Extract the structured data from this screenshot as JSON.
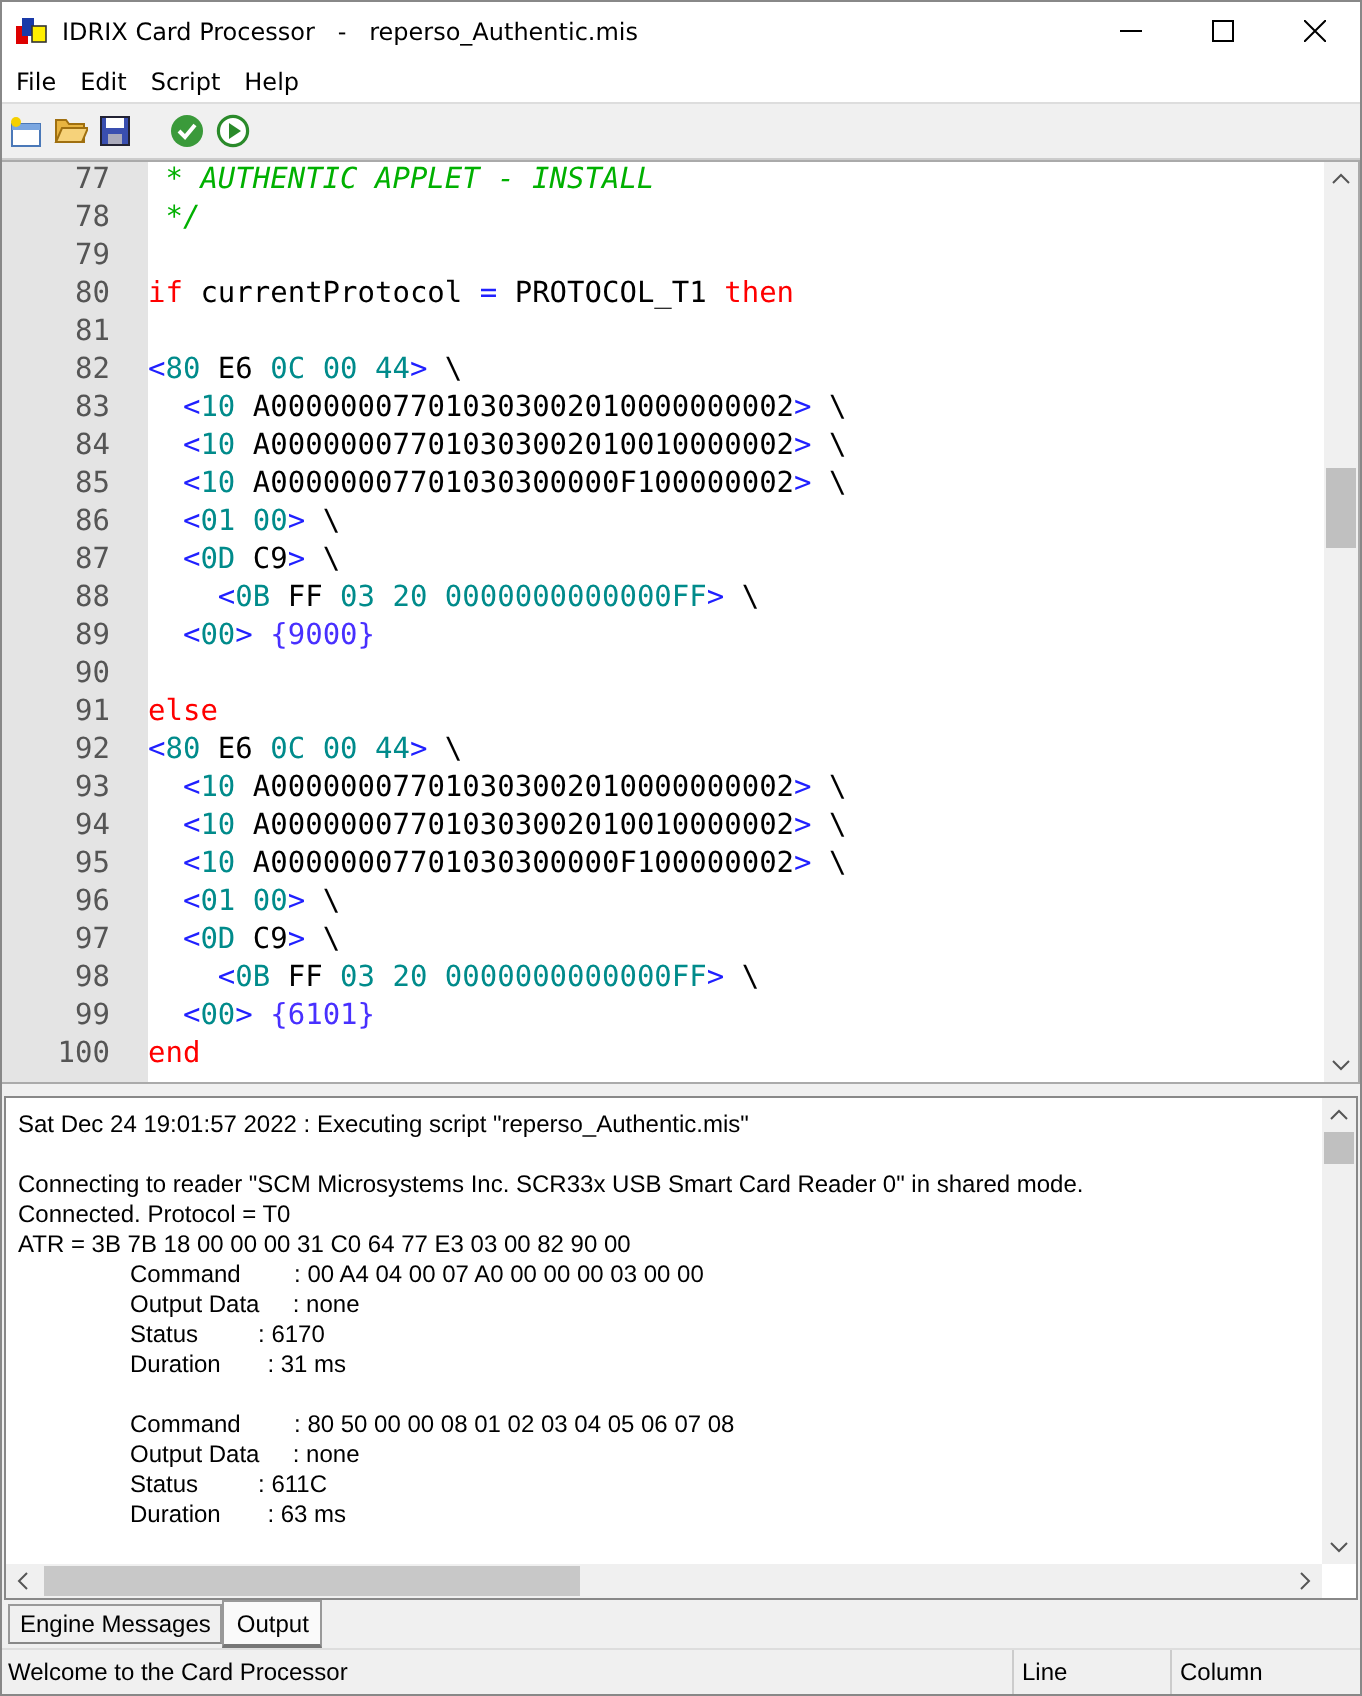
{
  "window": {
    "title": "IDRIX Card Processor   -   reperso_Authentic.mis"
  },
  "menu": [
    "File",
    "Edit",
    "Script",
    "Help"
  ],
  "editor": {
    "lines": [
      {
        "number": "77",
        "tokens": [
          {
            "kind": "comment",
            "text": " * AUTHENTIC APPLET - INSTALL"
          }
        ]
      },
      {
        "number": "78",
        "tokens": [
          {
            "kind": "comment",
            "text": " */"
          }
        ]
      },
      {
        "number": "79"
      },
      {
        "number": "80",
        "tokens": [
          {
            "kind": "keyword",
            "text": "if"
          },
          {
            "kind": "plain",
            "text": " currentProtocol "
          },
          {
            "kind": "punct",
            "text": "="
          },
          {
            "kind": "plain",
            "text": " PROTOCOL_T1 "
          },
          {
            "kind": "keyword",
            "text": "then"
          }
        ]
      },
      {
        "number": "81"
      },
      {
        "number": "82",
        "tokens": [
          {
            "kind": "punct",
            "text": "<"
          },
          {
            "kind": "num",
            "text": "80"
          },
          {
            "kind": "plain",
            "text": " E6 "
          },
          {
            "kind": "num",
            "text": "0C 00 44"
          },
          {
            "kind": "punct",
            "text": ">"
          },
          {
            "kind": "plain",
            "text": " \\"
          }
        ]
      },
      {
        "number": "83",
        "tokens": [
          {
            "kind": "punct",
            "text": "  <"
          },
          {
            "kind": "num",
            "text": "10"
          },
          {
            "kind": "plain",
            "text": " A000000077010303002010000000002"
          },
          {
            "kind": "punct",
            "text": ">"
          },
          {
            "kind": "plain",
            "text": " \\"
          }
        ]
      },
      {
        "number": "84",
        "tokens": [
          {
            "kind": "punct",
            "text": "  <"
          },
          {
            "kind": "num",
            "text": "10"
          },
          {
            "kind": "plain",
            "text": " A000000077010303002010010000002"
          },
          {
            "kind": "punct",
            "text": ">"
          },
          {
            "kind": "plain",
            "text": " \\"
          }
        ]
      },
      {
        "number": "85",
        "tokens": [
          {
            "kind": "punct",
            "text": "  <"
          },
          {
            "kind": "num",
            "text": "10"
          },
          {
            "kind": "plain",
            "text": " A00000007701030300000F100000002"
          },
          {
            "kind": "punct",
            "text": ">"
          },
          {
            "kind": "plain",
            "text": " \\"
          }
        ]
      },
      {
        "number": "86",
        "tokens": [
          {
            "kind": "punct",
            "text": "  <"
          },
          {
            "kind": "num",
            "text": "01 00"
          },
          {
            "kind": "punct",
            "text": ">"
          },
          {
            "kind": "plain",
            "text": " \\"
          }
        ]
      },
      {
        "number": "87",
        "tokens": [
          {
            "kind": "punct",
            "text": "  <"
          },
          {
            "kind": "num",
            "text": "0D"
          },
          {
            "kind": "plain",
            "text": " C9"
          },
          {
            "kind": "punct",
            "text": ">"
          },
          {
            "kind": "plain",
            "text": " \\"
          }
        ]
      },
      {
        "number": "88",
        "tokens": [
          {
            "kind": "punct",
            "text": "    <"
          },
          {
            "kind": "num",
            "text": "0B"
          },
          {
            "kind": "plain",
            "text": " FF "
          },
          {
            "kind": "num",
            "text": "03 20 0000000000000FF"
          },
          {
            "kind": "punct",
            "text": ">"
          },
          {
            "kind": "plain",
            "text": " \\"
          }
        ]
      },
      {
        "number": "89",
        "tokens": [
          {
            "kind": "punct",
            "text": "  <"
          },
          {
            "kind": "num",
            "text": "00"
          },
          {
            "kind": "punct",
            "text": ">"
          },
          {
            "kind": "response",
            "text": " {9000}"
          }
        ]
      },
      {
        "number": "90"
      },
      {
        "number": "91",
        "tokens": [
          {
            "kind": "keyword",
            "text": "else"
          }
        ]
      },
      {
        "number": "92",
        "tokens": [
          {
            "kind": "punct",
            "text": "<"
          },
          {
            "kind": "num",
            "text": "80"
          },
          {
            "kind": "plain",
            "text": " E6 "
          },
          {
            "kind": "num",
            "text": "0C 00 44"
          },
          {
            "kind": "punct",
            "text": ">"
          },
          {
            "kind": "plain",
            "text": " \\"
          }
        ]
      },
      {
        "number": "93",
        "tokens": [
          {
            "kind": "punct",
            "text": "  <"
          },
          {
            "kind": "num",
            "text": "10"
          },
          {
            "kind": "plain",
            "text": " A000000077010303002010000000002"
          },
          {
            "kind": "punct",
            "text": ">"
          },
          {
            "kind": "plain",
            "text": " \\"
          }
        ]
      },
      {
        "number": "94",
        "tokens": [
          {
            "kind": "punct",
            "text": "  <"
          },
          {
            "kind": "num",
            "text": "10"
          },
          {
            "kind": "plain",
            "text": " A000000077010303002010010000002"
          },
          {
            "kind": "punct",
            "text": ">"
          },
          {
            "kind": "plain",
            "text": " \\"
          }
        ]
      },
      {
        "number": "95",
        "tokens": [
          {
            "kind": "punct",
            "text": "  <"
          },
          {
            "kind": "num",
            "text": "10"
          },
          {
            "kind": "plain",
            "text": " A00000007701030300000F100000002"
          },
          {
            "kind": "punct",
            "text": ">"
          },
          {
            "kind": "plain",
            "text": " \\"
          }
        ]
      },
      {
        "number": "96",
        "tokens": [
          {
            "kind": "punct",
            "text": "  <"
          },
          {
            "kind": "num",
            "text": "01 00"
          },
          {
            "kind": "punct",
            "text": ">"
          },
          {
            "kind": "plain",
            "text": " \\"
          }
        ]
      },
      {
        "number": "97",
        "tokens": [
          {
            "kind": "punct",
            "text": "  <"
          },
          {
            "kind": "num",
            "text": "0D"
          },
          {
            "kind": "plain",
            "text": " C9"
          },
          {
            "kind": "punct",
            "text": ">"
          },
          {
            "kind": "plain",
            "text": " \\"
          }
        ]
      },
      {
        "number": "98",
        "tokens": [
          {
            "kind": "punct",
            "text": "    <"
          },
          {
            "kind": "num",
            "text": "0B"
          },
          {
            "kind": "plain",
            "text": " FF "
          },
          {
            "kind": "num",
            "text": "03 20 0000000000000FF"
          },
          {
            "kind": "punct",
            "text": ">"
          },
          {
            "kind": "plain",
            "text": " \\"
          }
        ]
      },
      {
        "number": "99",
        "tokens": [
          {
            "kind": "punct",
            "text": "  <"
          },
          {
            "kind": "num",
            "text": "00"
          },
          {
            "kind": "punct",
            "text": ">"
          },
          {
            "kind": "response",
            "text": " {6101}"
          }
        ]
      },
      {
        "number": "100",
        "tokens": [
          {
            "kind": "keyword",
            "text": "end"
          }
        ]
      }
    ]
  },
  "output": {
    "lines": [
      {
        "kind": "text",
        "text": "Sat Dec 24 19:01:57 2022 : Executing script \"reperso_Authentic.mis\""
      },
      {
        "kind": "blank"
      },
      {
        "kind": "text",
        "text": "Connecting to reader \"SCM Microsystems Inc. SCR33x USB Smart Card Reader 0\" in shared mode."
      },
      {
        "kind": "text",
        "text": "Connected. Protocol = T0"
      },
      {
        "kind": "text",
        "text": "ATR = 3B 7B 18 00 00 00 31 C0 64 77 E3 03 00 82 90 00"
      },
      {
        "kind": "detail",
        "text": "Command        : 00 A4 04 00 07 A0 00 00 00 03 00 00"
      },
      {
        "kind": "detail",
        "text": "Output Data     : none"
      },
      {
        "kind": "detail",
        "text": "Status         : 6170"
      },
      {
        "kind": "detail",
        "text": "Duration       : 31 ms"
      },
      {
        "kind": "blank"
      },
      {
        "kind": "detail",
        "text": "Command        : 80 50 00 00 08 01 02 03 04 05 06 07 08"
      },
      {
        "kind": "detail",
        "text": "Output Data     : none"
      },
      {
        "kind": "detail",
        "text": "Status         : 611C"
      },
      {
        "kind": "detail",
        "text": "Duration       : 63 ms"
      }
    ]
  },
  "tabs": [
    {
      "label": "Engine Messages",
      "selected": false
    },
    {
      "label": "Output",
      "selected": true
    }
  ],
  "status_bar": {
    "message": "Welcome to the Card Processor",
    "line_label": "Line",
    "column_label": "Column"
  }
}
